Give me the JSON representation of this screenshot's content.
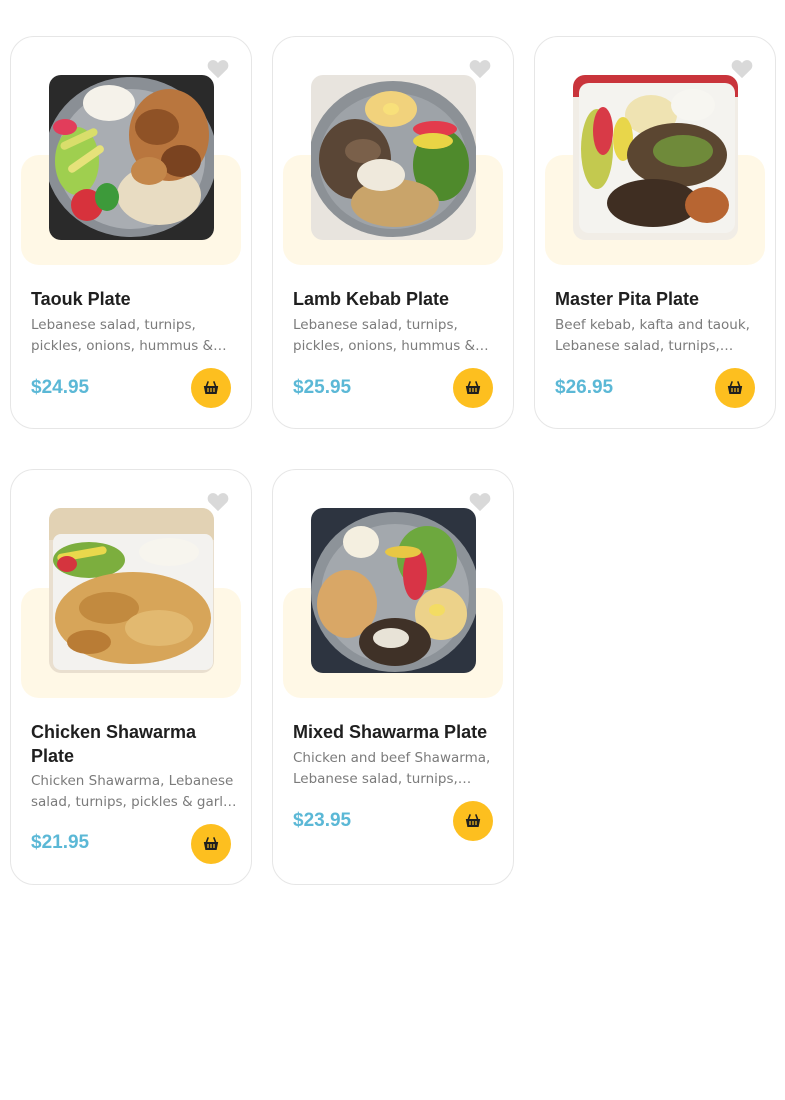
{
  "products": [
    {
      "name": "Taouk Plate",
      "description": "Lebanese salad, turnips, pickles, onions, hummus & garlic sauce",
      "price": "$24.95",
      "image": "grilled-chicken-plate",
      "favorite": false
    },
    {
      "name": "Lamb Kebab Plate",
      "description": "Lebanese salad, turnips, pickles, onions, hummus & tahini sauce",
      "price": "$25.95",
      "image": "lamb-kebab-plate",
      "favorite": false
    },
    {
      "name": "Master Pita Plate",
      "description": "Beef kebab, kafta and taouk, Lebanese salad, turnips, pickles",
      "price": "$26.95",
      "image": "mixed-grill-plate",
      "favorite": false
    },
    {
      "name": "Chicken Shawarma Plate",
      "description": "Chicken Shawarma, Lebanese salad, turnips, pickles & garlic sauce",
      "price": "$21.95",
      "image": "chicken-shawarma-plate",
      "favorite": false
    },
    {
      "name": "Mixed Shawarma Plate",
      "description": "Chicken and beef Shawarma, Lebanese salad, turnips, pickles",
      "price": "$23.95",
      "image": "mixed-shawarma-plate",
      "favorite": false
    }
  ],
  "icons": {
    "favorite": "heart-icon",
    "cart": "basket-icon"
  },
  "colors": {
    "price": "#5bb8d6",
    "cart_button": "#fdbf1f",
    "media_background": "#fff8e6",
    "heart_inactive": "#d9d9d9"
  }
}
